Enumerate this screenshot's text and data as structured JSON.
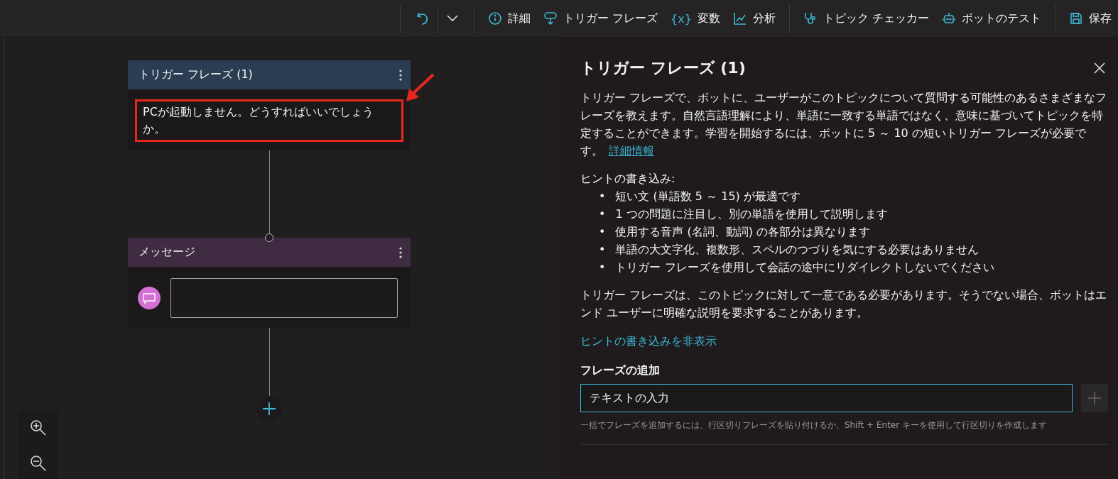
{
  "toolbar": {
    "items": [
      {
        "kind": "details",
        "label": "詳細"
      },
      {
        "kind": "trigger",
        "label": "トリガー フレーズ"
      },
      {
        "kind": "variables",
        "glyph": "{x}",
        "label": "変数"
      },
      {
        "kind": "analytics",
        "label": "分析"
      },
      {
        "kind": "checker",
        "label": "トピック チェッカー"
      },
      {
        "kind": "test",
        "label": "ボットのテスト"
      },
      {
        "kind": "save",
        "label": "保存"
      }
    ]
  },
  "canvas": {
    "nodes": [
      {
        "kind": "trigger",
        "title": "トリガー フレーズ (1)",
        "phrase": "PCが起動しません。どうすればいいでしょうか。",
        "highlighted": true
      },
      {
        "kind": "message",
        "title": "メッセージ"
      }
    ]
  },
  "panel": {
    "title": "トリガー フレーズ (1)",
    "intro": "トリガー フレーズで、ボットに、ユーザーがこのトピックについて質問する可能性のあるさまざまなフレーズを教えます。自然言語理解により、単語に一致する単語ではなく、意味に基づいてトピックを特定することができます。学習を開始するには、ボットに 5 ～ 10 の短いトリガー フレーズが必要です。",
    "intro_link": "詳細情報",
    "tips_heading": "ヒントの書き込み:",
    "tips": [
      {
        "marker": "•",
        "text": "短い文 (単語数 5 ～ 15) が最適です"
      },
      {
        "marker": "•",
        "text": "1 つの問題に注目し、別の単語を使用して説明します"
      },
      {
        "marker": "•",
        "text": "使用する音声 (名詞、動詞) の各部分は異なります"
      },
      {
        "marker": "•",
        "text": "単語の大文字化、複数形、スペルのつづりを気にする必要はありません"
      },
      {
        "marker": "•",
        "text": "トリガー フレーズを使用して会話の途中にリダイレクトしないでください"
      }
    ],
    "note": "トリガー フレーズは、このトピックに対して一意である必要があります。そうでない場合、ボットはエンド ユーザーに明確な説明を要求することがあります。",
    "hide_tips_link": "ヒントの書き込みを非表示",
    "add_label": "フレーズの追加",
    "add_field": {
      "value": "テキストの入力"
    },
    "help": "一括でフレーズを追加するには、行区切りフレーズを貼り付けるか、Shift + Enter キーを使用して行区切りを作成します"
  }
}
